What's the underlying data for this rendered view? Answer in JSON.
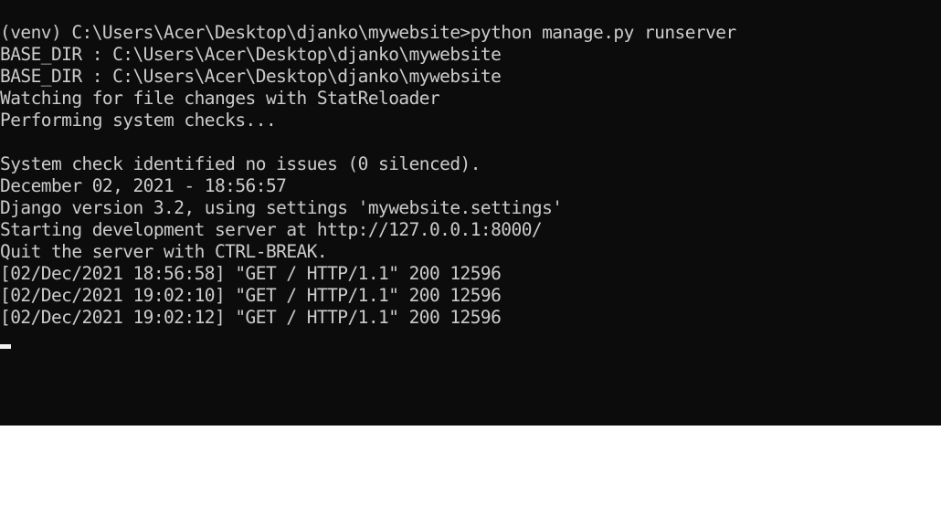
{
  "colors": {
    "terminal_background": "#0c0c0c",
    "terminal_text": "#cccccc",
    "cursor": "#f2f2f2",
    "page_background": "#ffffff"
  },
  "terminal": {
    "lines": [
      "(venv) C:\\Users\\Acer\\Desktop\\djanko\\mywebsite>python manage.py runserver",
      "BASE_DIR : C:\\Users\\Acer\\Desktop\\djanko\\mywebsite",
      "BASE_DIR : C:\\Users\\Acer\\Desktop\\djanko\\mywebsite",
      "Watching for file changes with StatReloader",
      "Performing system checks...",
      "",
      "System check identified no issues (0 silenced).",
      "December 02, 2021 - 18:56:57",
      "Django version 3.2, using settings 'mywebsite.settings'",
      "Starting development server at http://127.0.0.1:8000/",
      "Quit the server with CTRL-BREAK.",
      "[02/Dec/2021 18:56:58] \"GET / HTTP/1.1\" 200 12596",
      "[02/Dec/2021 19:02:10] \"GET / HTTP/1.1\" 200 12596",
      "[02/Dec/2021 19:02:12] \"GET / HTTP/1.1\" 200 12596"
    ]
  }
}
